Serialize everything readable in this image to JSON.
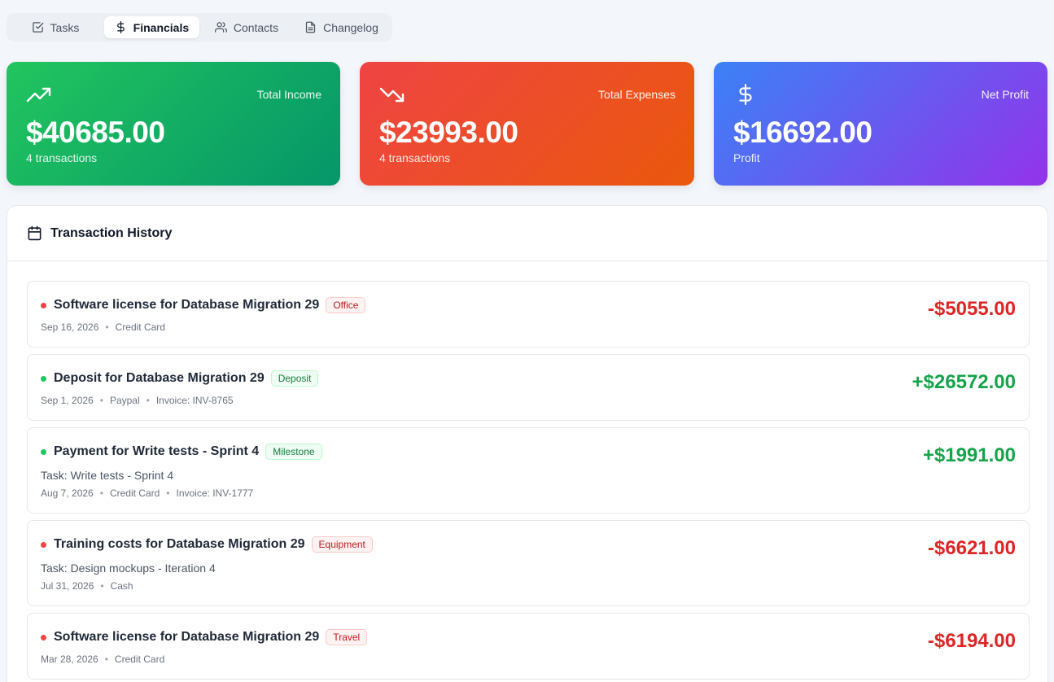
{
  "tabs": [
    {
      "label": "Tasks",
      "icon": "checkbox-icon",
      "active": false
    },
    {
      "label": "Financials",
      "icon": "dollar-icon",
      "active": true
    },
    {
      "label": "Contacts",
      "icon": "users-icon",
      "active": false
    },
    {
      "label": "Changelog",
      "icon": "document-icon",
      "active": false
    }
  ],
  "summary": {
    "income": {
      "label": "Total Income",
      "value": "$40685.00",
      "sub": "4 transactions",
      "icon": "trending-up-icon"
    },
    "expenses": {
      "label": "Total Expenses",
      "value": "$23993.00",
      "sub": "4 transactions",
      "icon": "trending-down-icon"
    },
    "profit": {
      "label": "Net Profit",
      "value": "$16692.00",
      "sub": "Profit",
      "icon": "dollar-icon"
    }
  },
  "history": {
    "title": "Transaction History",
    "icon": "calendar-icon",
    "transactions": [
      {
        "title": "Software license for Database Migration 29",
        "badge": "Office",
        "type": "expense",
        "date": "Sep 16, 2026",
        "method": "Credit Card",
        "amount": "-$5055.00"
      },
      {
        "title": "Deposit for Database Migration 29",
        "badge": "Deposit",
        "type": "income",
        "date": "Sep 1, 2026",
        "method": "Paypal",
        "invoice": "Invoice: INV-8765",
        "amount": "+$26572.00"
      },
      {
        "title": "Payment for Write tests - Sprint 4",
        "badge": "Milestone",
        "type": "income",
        "task": "Task: Write tests - Sprint 4",
        "date": "Aug 7, 2026",
        "method": "Credit Card",
        "invoice": "Invoice: INV-1777",
        "amount": "+$1991.00"
      },
      {
        "title": "Training costs for Database Migration 29",
        "badge": "Equipment",
        "type": "expense",
        "task": "Task: Design mockups - Iteration 4",
        "date": "Jul 31, 2026",
        "method": "Cash",
        "amount": "-$6621.00"
      },
      {
        "title": "Software license for Database Migration 29",
        "badge": "Travel",
        "type": "expense",
        "date": "Mar 28, 2026",
        "method": "Credit Card",
        "amount": "-$6194.00"
      }
    ]
  },
  "colors": {
    "income_gradient": [
      "#22c55e",
      "#059669"
    ],
    "expense_gradient": [
      "#ef4444",
      "#ea580c"
    ],
    "profit_gradient": [
      "#3b82f6",
      "#9333ea"
    ],
    "positive": "#16a34a",
    "negative": "#dc2626"
  }
}
